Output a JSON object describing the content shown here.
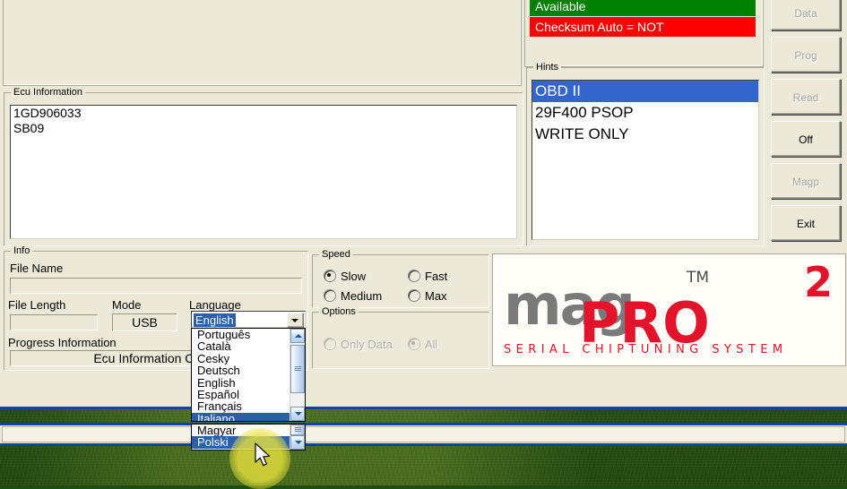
{
  "app": {
    "ecu_group_title": "Ecu Information",
    "ecu_lines": [
      "1GD906033",
      "  SB09"
    ],
    "status": {
      "green_text": "Available",
      "green_color": "#008000",
      "red_text": "Checksum Auto = NOT",
      "red_color": "#ff0000"
    },
    "hints": {
      "title": "Hints",
      "items": [
        "OBD II",
        "29F400 PSOP",
        "WRITE ONLY"
      ],
      "selected_index": 0,
      "selection_color": "#3366cc"
    },
    "buttons": [
      {
        "label": "Data",
        "enabled": false
      },
      {
        "label": "Prog",
        "enabled": false
      },
      {
        "label": "Read",
        "enabled": false
      },
      {
        "label": "Off",
        "enabled": true
      },
      {
        "label": "Magp",
        "enabled": false
      },
      {
        "label": "Exit",
        "enabled": true
      }
    ],
    "info": {
      "title": "Info",
      "file_name_label": "File Name",
      "file_name_value": "",
      "file_length_label": "File Length",
      "file_length_value": "",
      "mode_label": "Mode",
      "mode_value": "USB",
      "language_label": "Language",
      "progress_label": "Progress Information",
      "progress_value": "Ecu Information Comp"
    },
    "speed": {
      "title": "Speed",
      "options": [
        {
          "label": "Slow",
          "selected": true
        },
        {
          "label": "Fast",
          "selected": false
        },
        {
          "label": "Medium",
          "selected": false
        },
        {
          "label": "Max",
          "selected": false
        }
      ]
    },
    "options": {
      "title": "Options",
      "items": [
        {
          "label": "Only Data",
          "selected": false,
          "enabled": false
        },
        {
          "label": "All",
          "selected": true,
          "enabled": false
        }
      ]
    },
    "language_combo": {
      "value": "English",
      "open": true,
      "visible_options": [
        {
          "label": "Português",
          "selected": false
        },
        {
          "label": "Català",
          "selected": false
        },
        {
          "label": "Cesky",
          "selected": false
        },
        {
          "label": "Deutsch",
          "selected": false
        },
        {
          "label": "English",
          "selected": false
        },
        {
          "label": "Español",
          "selected": false
        },
        {
          "label": "Français",
          "selected": false
        },
        {
          "label": "Italiano",
          "selected": true
        }
      ],
      "trailing_options": [
        {
          "label": "Magyar",
          "selected": false
        },
        {
          "label": "Polski",
          "selected": true
        }
      ],
      "highlight_color": "#2a5fb0"
    },
    "logo": {
      "mag": "mag",
      "pro": "PRO",
      "superscript": "2",
      "trademark": "TM",
      "subtitle": "SERIAL CHIPTUNING SYSTEM",
      "gray": "#7a7a7a",
      "red": "#e3132b"
    }
  }
}
